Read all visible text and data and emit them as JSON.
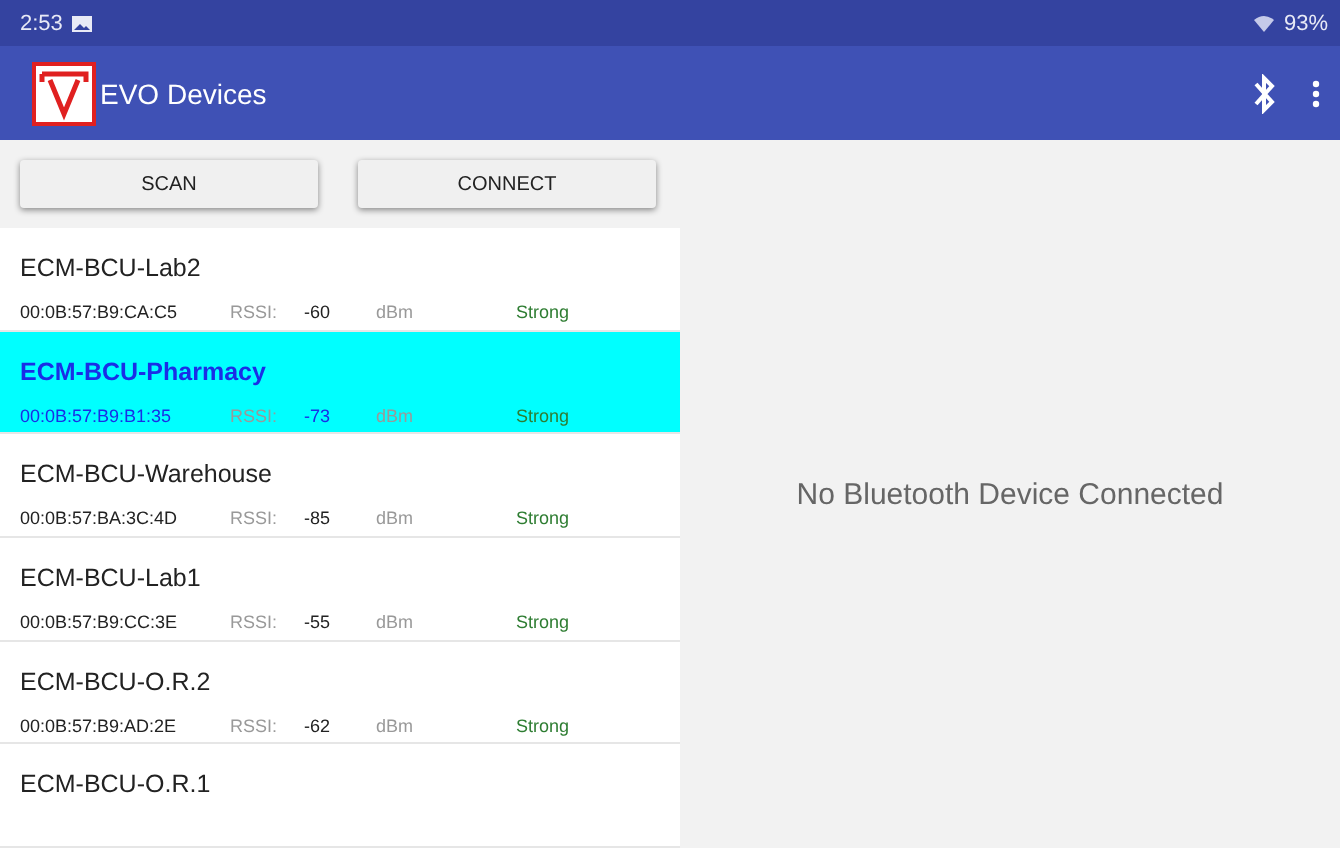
{
  "status_bar": {
    "time": "2:53",
    "battery": "93%"
  },
  "app_bar": {
    "title": "EVO Devices"
  },
  "buttons": [
    "SCAN",
    "CONNECT"
  ],
  "devices": [
    {
      "name": "ECM-BCU-Lab2",
      "mac": "00:0B:57:B9:CA:C5",
      "rssi_label": "RSSI:",
      "rssi": "-60",
      "unit": "dBm",
      "strength": "Strong",
      "selected": false
    },
    {
      "name": "ECM-BCU-Pharmacy",
      "mac": "00:0B:57:B9:B1:35",
      "rssi_label": "RSSI:",
      "rssi": "-73",
      "unit": "dBm",
      "strength": "Strong",
      "selected": true
    },
    {
      "name": "ECM-BCU-Warehouse",
      "mac": "00:0B:57:BA:3C:4D",
      "rssi_label": "RSSI:",
      "rssi": "-85",
      "unit": "dBm",
      "strength": "Strong",
      "selected": false
    },
    {
      "name": "ECM-BCU-Lab1",
      "mac": "00:0B:57:B9:CC:3E",
      "rssi_label": "RSSI:",
      "rssi": "-55",
      "unit": "dBm",
      "strength": "Strong",
      "selected": false
    },
    {
      "name": "ECM-BCU-O.R.2",
      "mac": "00:0B:57:B9:AD:2E",
      "rssi_label": "RSSI:",
      "rssi": "-62",
      "unit": "dBm",
      "strength": "Strong",
      "selected": false
    },
    {
      "name": "ECM-BCU-O.R.1",
      "selected": false
    }
  ],
  "status_message": "No Bluetooth Device Connected"
}
